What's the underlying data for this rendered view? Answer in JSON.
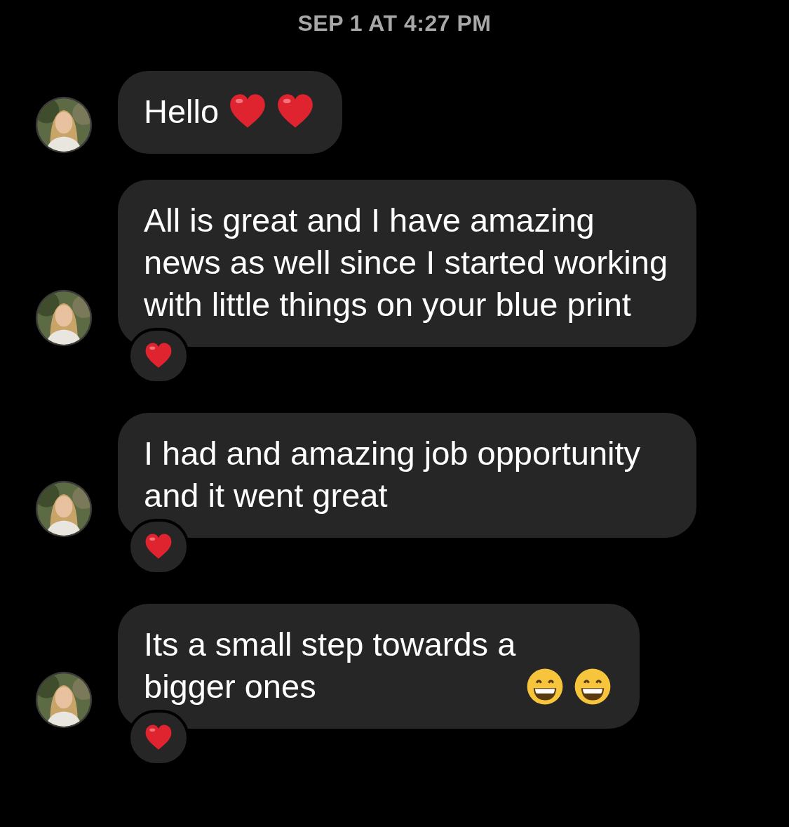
{
  "timestamp": "SEP 1 AT 4:27 PM",
  "messages": [
    {
      "text": "Hello",
      "emojis": [
        {
          "kind": "heart"
        },
        {
          "kind": "heart"
        }
      ]
    },
    {
      "text": "All is great and I have amazing news as well since I started working with little things on your blue print",
      "reaction": {
        "kind": "heart"
      }
    },
    {
      "text": "I had and amazing job opportunity and it went great",
      "reaction": {
        "kind": "heart"
      }
    },
    {
      "text": "Its a small step towards a bigger ones",
      "emojis": [
        {
          "kind": "grin"
        },
        {
          "kind": "grin"
        }
      ],
      "reaction": {
        "kind": "heart"
      }
    }
  ]
}
